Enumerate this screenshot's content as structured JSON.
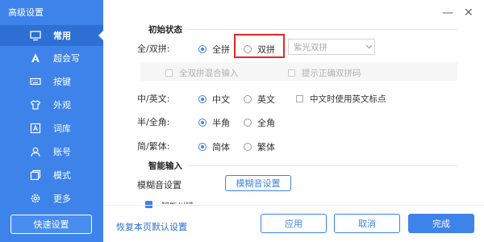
{
  "window": {
    "title": "高级设置",
    "minimize_symbol": "—",
    "close_symbol": "✕"
  },
  "sidebar": {
    "items": [
      {
        "label": "常用",
        "icon": "monitor-icon",
        "active": true
      },
      {
        "label": "超会写",
        "icon": "pen-icon",
        "active": false
      },
      {
        "label": "按键",
        "icon": "keyboard-icon",
        "active": false
      },
      {
        "label": "外观",
        "icon": "shirt-icon",
        "active": false
      },
      {
        "label": "词库",
        "icon": "dictionary-icon",
        "active": false
      },
      {
        "label": "账号",
        "icon": "user-icon",
        "active": false
      },
      {
        "label": "模式",
        "icon": "window-icon",
        "active": false
      },
      {
        "label": "更多",
        "icon": "gear-icon",
        "active": false
      }
    ],
    "quick_settings": "快速设置"
  },
  "initial_state": {
    "title": "初始状态",
    "full_double": {
      "label": "全/双拼:",
      "option_full": "全拼",
      "option_double": "双拼",
      "selected": "全拼",
      "scheme": "紫光双拼",
      "mixed_input": "全双拼混合输入",
      "show_correct": "提示正确双拼码"
    },
    "cn_en": {
      "label": "中/英文:",
      "option_cn": "中文",
      "option_en": "英文",
      "selected": "中文",
      "punct_checkbox": "中文时使用英文标点"
    },
    "half_full": {
      "label": "半/全角:",
      "option_half": "半角",
      "option_full": "全角",
      "selected": "半角"
    },
    "simp_trad": {
      "label": "简/繁体:",
      "option_simp": "简体",
      "option_trad": "繁体",
      "selected": "简体"
    }
  },
  "smart_input": {
    "title": "智能输入",
    "fuzzy_label": "模糊音设置",
    "fuzzy_button": "模糊音设置",
    "cut_text": "智能纠错"
  },
  "footer": {
    "restore": "恢复本页默认设置",
    "apply": "应用",
    "cancel": "取消",
    "done": "完成"
  },
  "colors": {
    "accent": "#3d83ea",
    "sidebar": "#3d83ea",
    "highlight": "#e52828"
  }
}
